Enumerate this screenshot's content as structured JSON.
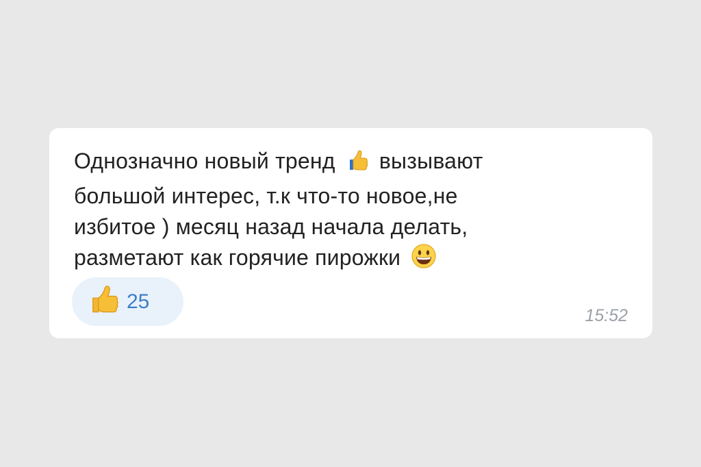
{
  "message": {
    "line1_a": "Однозначно новый тренд",
    "line1_emoji": "thumbs-up-icon",
    "line1_b": "вызывают",
    "line2": "большой интерес, т.к что-то новое,не",
    "line3": "избитое ) месяц назад начала делать,",
    "line4": "разметают как горячие пирожки",
    "line4_emoji": "grinning-face-icon"
  },
  "reaction": {
    "icon": "thumbs-up-icon",
    "count": "25"
  },
  "timestamp": "15:52",
  "colors": {
    "background": "#e8e8e9",
    "bubble": "#ffffff",
    "reaction_bg": "#e9f1fb",
    "reaction_count": "#3a7fc8",
    "timestamp": "#9aa0a8"
  }
}
